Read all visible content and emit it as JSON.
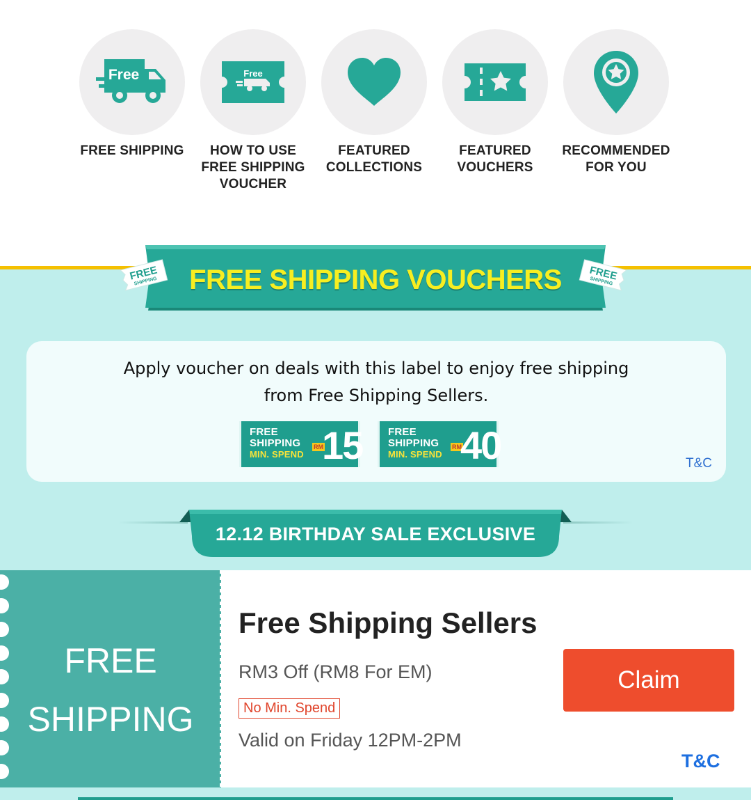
{
  "nav": {
    "items": [
      {
        "label": "FREE SHIPPING",
        "icon": "free-truck-icon"
      },
      {
        "label": "HOW TO USE\nFREE SHIPPING\nVOUCHER",
        "icon": "free-voucher-ticket-icon"
      },
      {
        "label": "FEATURED\nCOLLECTIONS",
        "icon": "heart-icon"
      },
      {
        "label": "FEATURED\nVOUCHERS",
        "icon": "star-ticket-icon"
      },
      {
        "label": "RECOMMENDED\nFOR YOU",
        "icon": "star-location-pin-icon"
      }
    ],
    "truck_text": "Free",
    "ticket_text": "Free"
  },
  "section": {
    "title": "FREE SHIPPING VOUCHERS",
    "tag_top": "FREE",
    "tag_bottom": "SHIPPING",
    "info_text": "Apply voucher on deals with this label to enjoy free shipping\nfrom Free Shipping Sellers.",
    "badges": [
      {
        "line1": "FREE",
        "line2": "SHIPPING",
        "line3": "MIN. SPEND",
        "currency": "RM",
        "amount": "15"
      },
      {
        "line1": "FREE",
        "line2": "SHIPPING",
        "line3": "MIN. SPEND",
        "currency": "RM",
        "amount": "40"
      }
    ],
    "tc": "T&C",
    "ribbon": "12.12 BIRTHDAY SALE EXCLUSIVE"
  },
  "voucher": {
    "left_text": "FREE\nSHIPPING",
    "title": "Free Shipping Sellers",
    "subtitle": "RM3 Off (RM8 For EM)",
    "tag": "No Min. Spend",
    "valid": "Valid on Friday 12PM-2PM",
    "claim": "Claim",
    "tc": "T&C"
  },
  "colors": {
    "teal": "#26a897",
    "section_bg": "#bfeeec",
    "banner_text": "#f7ee21",
    "claim": "#ee4d2d",
    "link": "#1d6fe0",
    "gold": "#f5c000"
  }
}
